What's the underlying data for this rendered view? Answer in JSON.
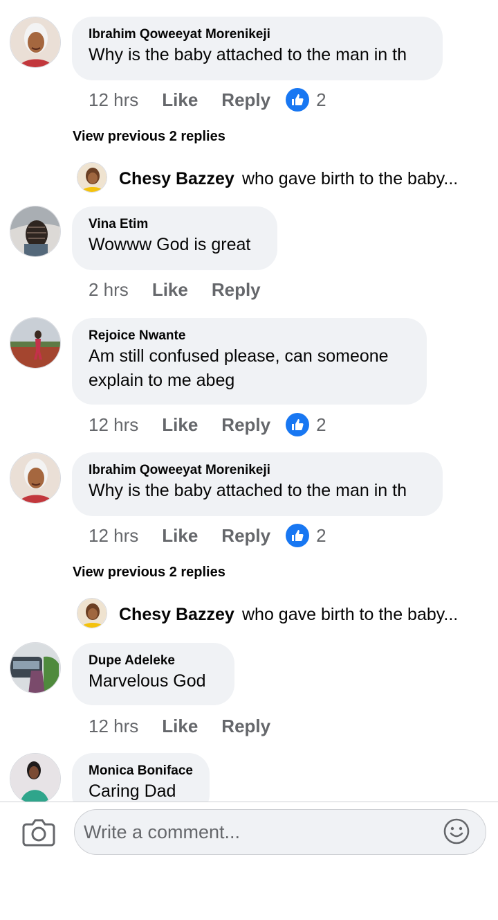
{
  "comments": [
    {
      "name": "Ibrahim Qoweeyat Morenikeji",
      "text": "Why is the baby attached to the man in th",
      "time": "12 hrs",
      "like": "Like",
      "reply": "Reply",
      "reactions": "2",
      "view_previous": "View previous 2 replies",
      "reply_preview": {
        "name": "Chesy Bazzey",
        "text": "who gave birth to the baby..."
      }
    },
    {
      "name": "Vina Etim",
      "text": "Wowww God is great",
      "time": "2 hrs",
      "like": "Like",
      "reply": "Reply"
    },
    {
      "name": "Rejoice Nwante",
      "text": "Am still confused please, can someone explain to me abeg",
      "time": "12 hrs",
      "like": "Like",
      "reply": "Reply",
      "reactions": "2"
    },
    {
      "name": "Ibrahim Qoweeyat Morenikeji",
      "text": "Why is the baby attached to the man in th",
      "time": "12 hrs",
      "like": "Like",
      "reply": "Reply",
      "reactions": "2",
      "view_previous": "View previous 2 replies",
      "reply_preview": {
        "name": "Chesy Bazzey",
        "text": "who gave birth to the baby..."
      }
    },
    {
      "name": "Dupe Adeleke",
      "text": "Marvelous God",
      "time": "12 hrs",
      "like": "Like",
      "reply": "Reply"
    },
    {
      "name": "Monica Boniface",
      "text": "Caring Dad"
    }
  ],
  "composer": {
    "placeholder": "Write a comment...",
    "camera_icon": "camera-icon",
    "emoji_icon": "emoji-icon"
  },
  "colors": {
    "bubble": "#f0f2f5",
    "secondary_text": "#65676b",
    "like_blue": "#1877f2"
  }
}
